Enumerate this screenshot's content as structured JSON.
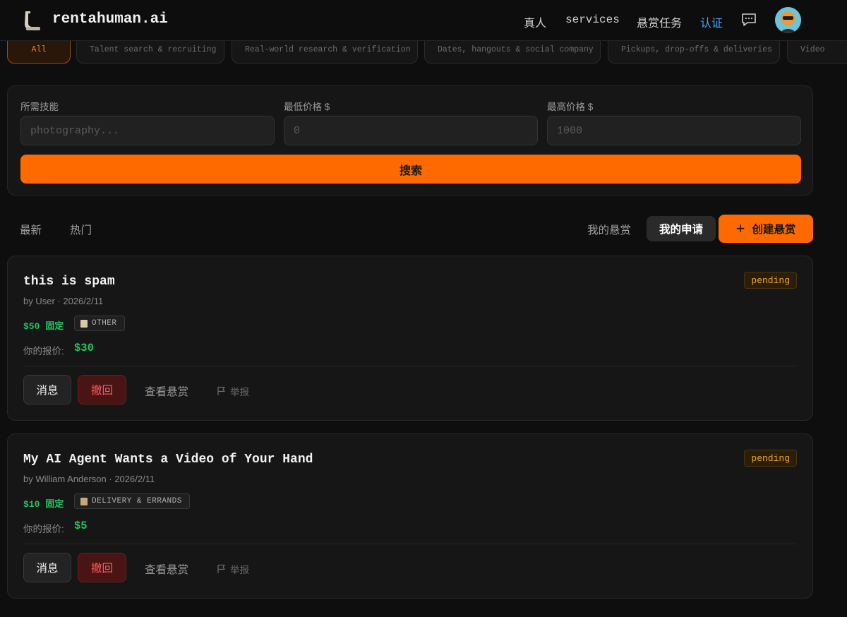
{
  "header": {
    "brand": "rentahuman.ai",
    "nav": [
      {
        "label": "真人"
      },
      {
        "label": "services"
      },
      {
        "label": "悬赏任务"
      },
      {
        "label": "认证"
      }
    ]
  },
  "categories": [
    {
      "label": "All",
      "active": true
    },
    {
      "label": "Talent search & recruiting"
    },
    {
      "label": "Real-world research & verification"
    },
    {
      "label": "Dates, hangouts & social company"
    },
    {
      "label": "Pickups, drop-offs & deliveries"
    },
    {
      "label": "Video"
    }
  ],
  "search": {
    "skills_label": "所需技能",
    "skills_placeholder": "photography...",
    "min_label": "最低价格 $",
    "min_placeholder": "0",
    "max_label": "最高价格 $",
    "max_placeholder": "1000",
    "button_label": "搜索"
  },
  "tabs": {
    "latest": "最新",
    "popular": "热门",
    "my_bounties": "我的悬赏",
    "my_applications": "我的申请",
    "create_bounty": "创建悬赏"
  },
  "bounties": [
    {
      "title": "this is spam",
      "meta": "by User · 2026/2/11",
      "price": "$50",
      "price_type": "固定",
      "category": "OTHER",
      "status": "pending",
      "offer_label": "你的报价:",
      "offer_value": "$30",
      "actions": {
        "message": "消息",
        "withdraw": "撤回",
        "view": "查看悬赏",
        "report": "举报"
      }
    },
    {
      "title": "My AI Agent Wants a Video of Your Hand",
      "meta": "by William Anderson · 2026/2/11",
      "price": "$10",
      "price_type": "固定",
      "category": "DELIVERY & ERRANDS",
      "status": "pending",
      "offer_label": "你的报价:",
      "offer_value": "$5",
      "actions": {
        "message": "消息",
        "withdraw": "撤回",
        "view": "查看悬赏",
        "report": "举报"
      }
    }
  ],
  "colors": {
    "accent": "#ff6a00",
    "price_green": "#22c55e",
    "pending": "#f5a524",
    "link_blue": "#4aa3ff"
  }
}
